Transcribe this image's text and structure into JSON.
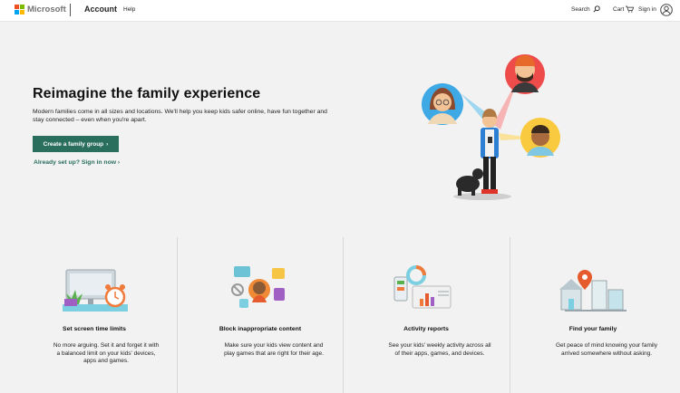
{
  "header": {
    "brand": "Microsoft",
    "section": "Account",
    "help": "Help",
    "search": "Search",
    "cart": "Cart",
    "sign_in": "Sign in",
    "logo_colors": [
      "#f25022",
      "#7fba00",
      "#00a4ef",
      "#ffb900"
    ]
  },
  "hero": {
    "title": "Reimagine the family experience",
    "description": "Modern families come in all sizes and locations. We'll help you keep kids safer online, have fun together and stay connected – even when you're apart.",
    "cta_label": "Create a family group",
    "signin_link": "Already set up? Sign in now",
    "accent_color": "#2a6e5e"
  },
  "features": [
    {
      "icon": "screen-time-illustration",
      "title": "Set screen time limits",
      "description": "No more arguing. Set it and forget it with a balanced limit on your kids' devices, apps and games."
    },
    {
      "icon": "content-filter-illustration",
      "title": "Block inappropriate content",
      "description": "Make sure your kids view content and play games that are right for their age."
    },
    {
      "icon": "activity-report-illustration",
      "title": "Activity reports",
      "description": "See your kids' weekly activity across all of their apps, games, and devices."
    },
    {
      "icon": "location-illustration",
      "title": "Find your family",
      "description": "Get peace of mind knowing your family arrived somewhere without asking."
    }
  ]
}
